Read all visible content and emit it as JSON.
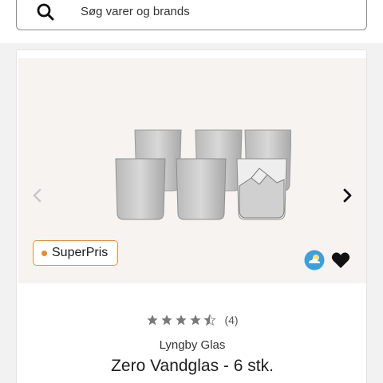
{
  "search": {
    "placeholder": "Søg varer og brands",
    "icon": "search-icon"
  },
  "product": {
    "badge_label": "SuperPris",
    "badge_color": "#e3913a",
    "rating_value": 4.5,
    "rating_max": 5,
    "review_count": "(4)",
    "brand": "Lyngby Glas",
    "title": "Zero Vandglas - 6 stk.",
    "image_alt": "6 water glasses",
    "icons": {
      "prev": "chevron-left-icon",
      "next": "chevron-right-icon",
      "weather": "weather-icon",
      "favorite": "heart-icon"
    }
  }
}
